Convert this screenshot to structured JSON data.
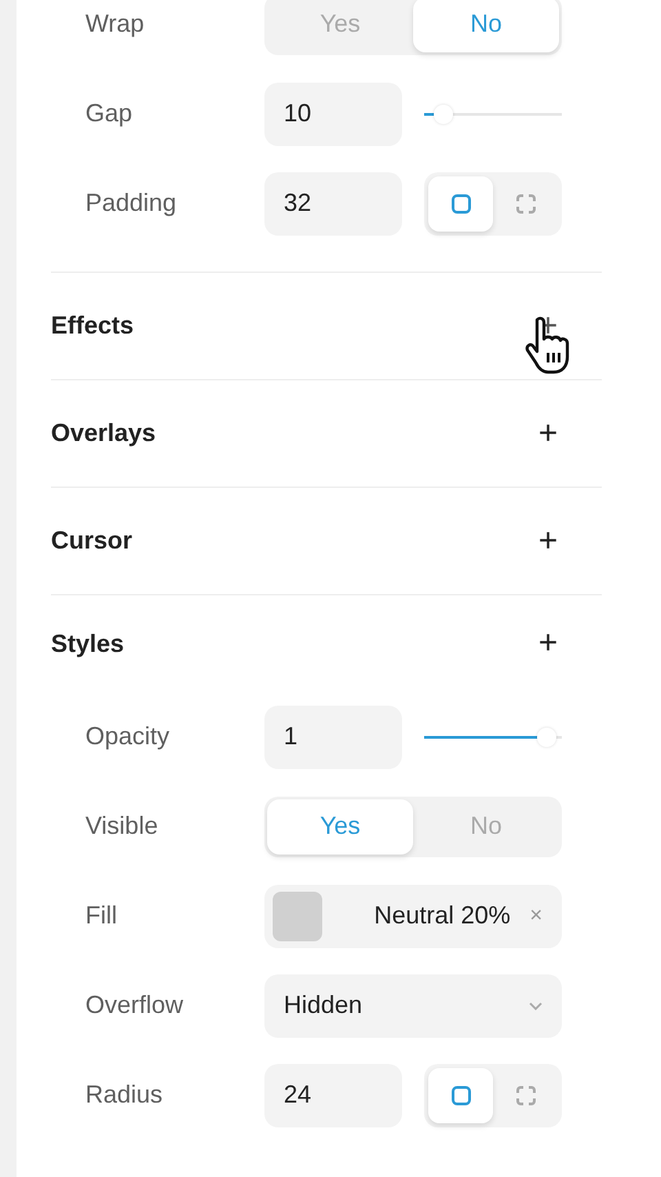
{
  "top_rows": [
    {
      "kind": "segmented",
      "label": "Wrap",
      "options": [
        {
          "label": "Yes",
          "selected": false
        },
        {
          "label": "No",
          "selected": true
        }
      ]
    },
    {
      "kind": "slider",
      "label": "Gap",
      "value": "10",
      "level": 0.08
    },
    {
      "kind": "corners",
      "label": "Padding",
      "value": "32",
      "modes": [
        {
          "selected": true
        },
        {
          "selected": false
        }
      ]
    }
  ],
  "sections": [
    {
      "title": "Effects",
      "action": "+",
      "hovered": true
    },
    {
      "title": "Overlays",
      "action": "+",
      "hovered": false
    },
    {
      "title": "Cursor",
      "action": "+",
      "hovered": false
    },
    {
      "title": "Styles",
      "action": "+",
      "hovered": false,
      "rows": [
        {
          "kind": "slider",
          "label": "Opacity",
          "value": "1",
          "level": 0.95
        },
        {
          "kind": "segmented",
          "label": "Visible",
          "options": [
            {
              "label": "Yes",
              "selected": true
            },
            {
              "label": "No",
              "selected": false
            }
          ]
        },
        {
          "kind": "color",
          "label": "Fill",
          "value": "Neutral 20%",
          "clear": "×"
        },
        {
          "kind": "dropdown",
          "label": "Overflow",
          "value": "Hidden"
        },
        {
          "kind": "corners",
          "label": "Radius",
          "value": "24",
          "modes": [
            {
              "selected": true
            },
            {
              "selected": false
            }
          ]
        }
      ]
    }
  ]
}
